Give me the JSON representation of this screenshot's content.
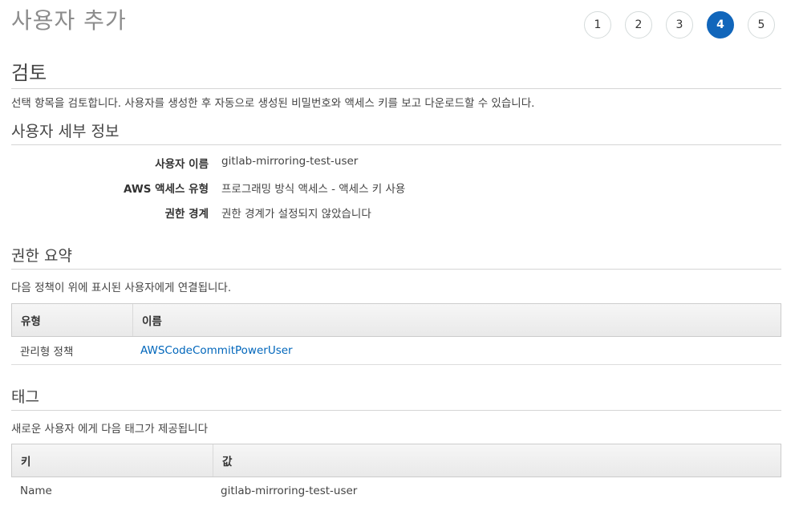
{
  "header": {
    "title": "사용자 추가",
    "steps": [
      "1",
      "2",
      "3",
      "4",
      "5"
    ],
    "active_step": "4"
  },
  "review": {
    "title": "검토",
    "description": "선택 항목을 검토합니다. 사용자를 생성한 후 자동으로 생성된 비밀번호와 액세스 키를 보고 다운로드할 수 있습니다."
  },
  "user_details": {
    "title": "사용자 세부 정보",
    "rows": [
      {
        "label": "사용자 이름",
        "value": "gitlab-mirroring-test-user"
      },
      {
        "label": "AWS 액세스 유형",
        "value": "프로그래밍 방식 액세스 - 액세스 키 사용"
      },
      {
        "label": "권한 경계",
        "value": "권한 경계가 설정되지 않았습니다"
      }
    ]
  },
  "permissions": {
    "title": "권한 요약",
    "description": "다음 정책이 위에 표시된 사용자에게 연결됩니다.",
    "columns": [
      "유형",
      "이름"
    ],
    "rows": [
      {
        "type": "관리형 정책",
        "name": "AWSCodeCommitPowerUser"
      }
    ]
  },
  "tags": {
    "title": "태그",
    "description": "새로운 사용자 에게 다음 태그가 제공됩니다",
    "columns": [
      "키",
      "값"
    ],
    "rows": [
      {
        "key": "Name",
        "value": "gitlab-mirroring-test-user"
      }
    ]
  },
  "colors": {
    "accent": "#1166bb",
    "link": "#0066bb",
    "title_gray": "#8c8c8c"
  }
}
